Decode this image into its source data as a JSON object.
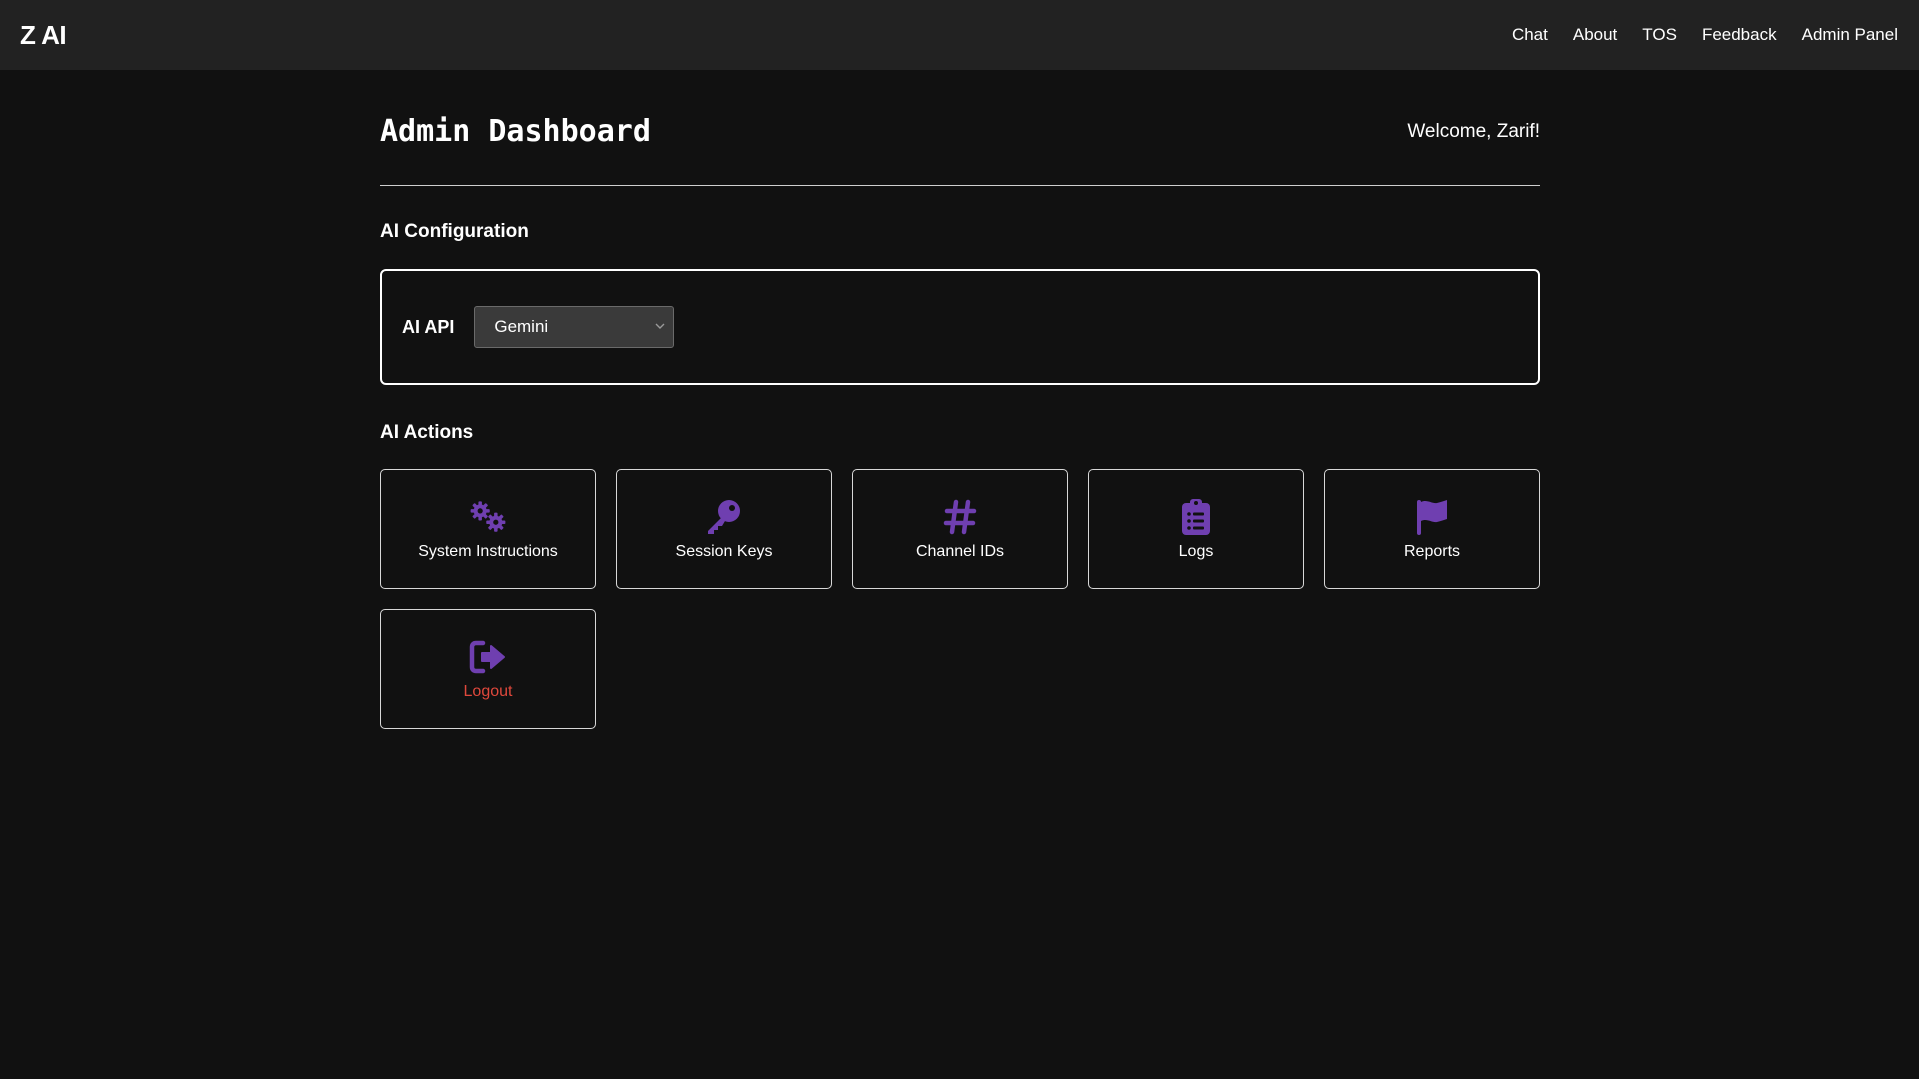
{
  "app": {
    "brand": "Z AI"
  },
  "nav": {
    "links": [
      "Chat",
      "About",
      "TOS",
      "Feedback",
      "Admin Panel"
    ]
  },
  "header": {
    "title": "Admin Dashboard",
    "welcome": "Welcome, Zarif!"
  },
  "config": {
    "section_title": "AI Configuration",
    "api_label": "AI API",
    "api_selected": "Gemini"
  },
  "actions": {
    "section_title": "AI Actions",
    "items": [
      {
        "label": "System Instructions",
        "icon": "gears-icon"
      },
      {
        "label": "Session Keys",
        "icon": "key-icon"
      },
      {
        "label": "Channel IDs",
        "icon": "hashtag-icon"
      },
      {
        "label": "Logs",
        "icon": "clipboard-list-icon"
      },
      {
        "label": "Reports",
        "icon": "flag-icon"
      },
      {
        "label": "Logout",
        "icon": "sign-out-icon"
      }
    ]
  },
  "colors": {
    "background": "#111111",
    "navbar": "#222222",
    "icon_accent": "#6f3fb0",
    "danger": "#e0483c"
  }
}
